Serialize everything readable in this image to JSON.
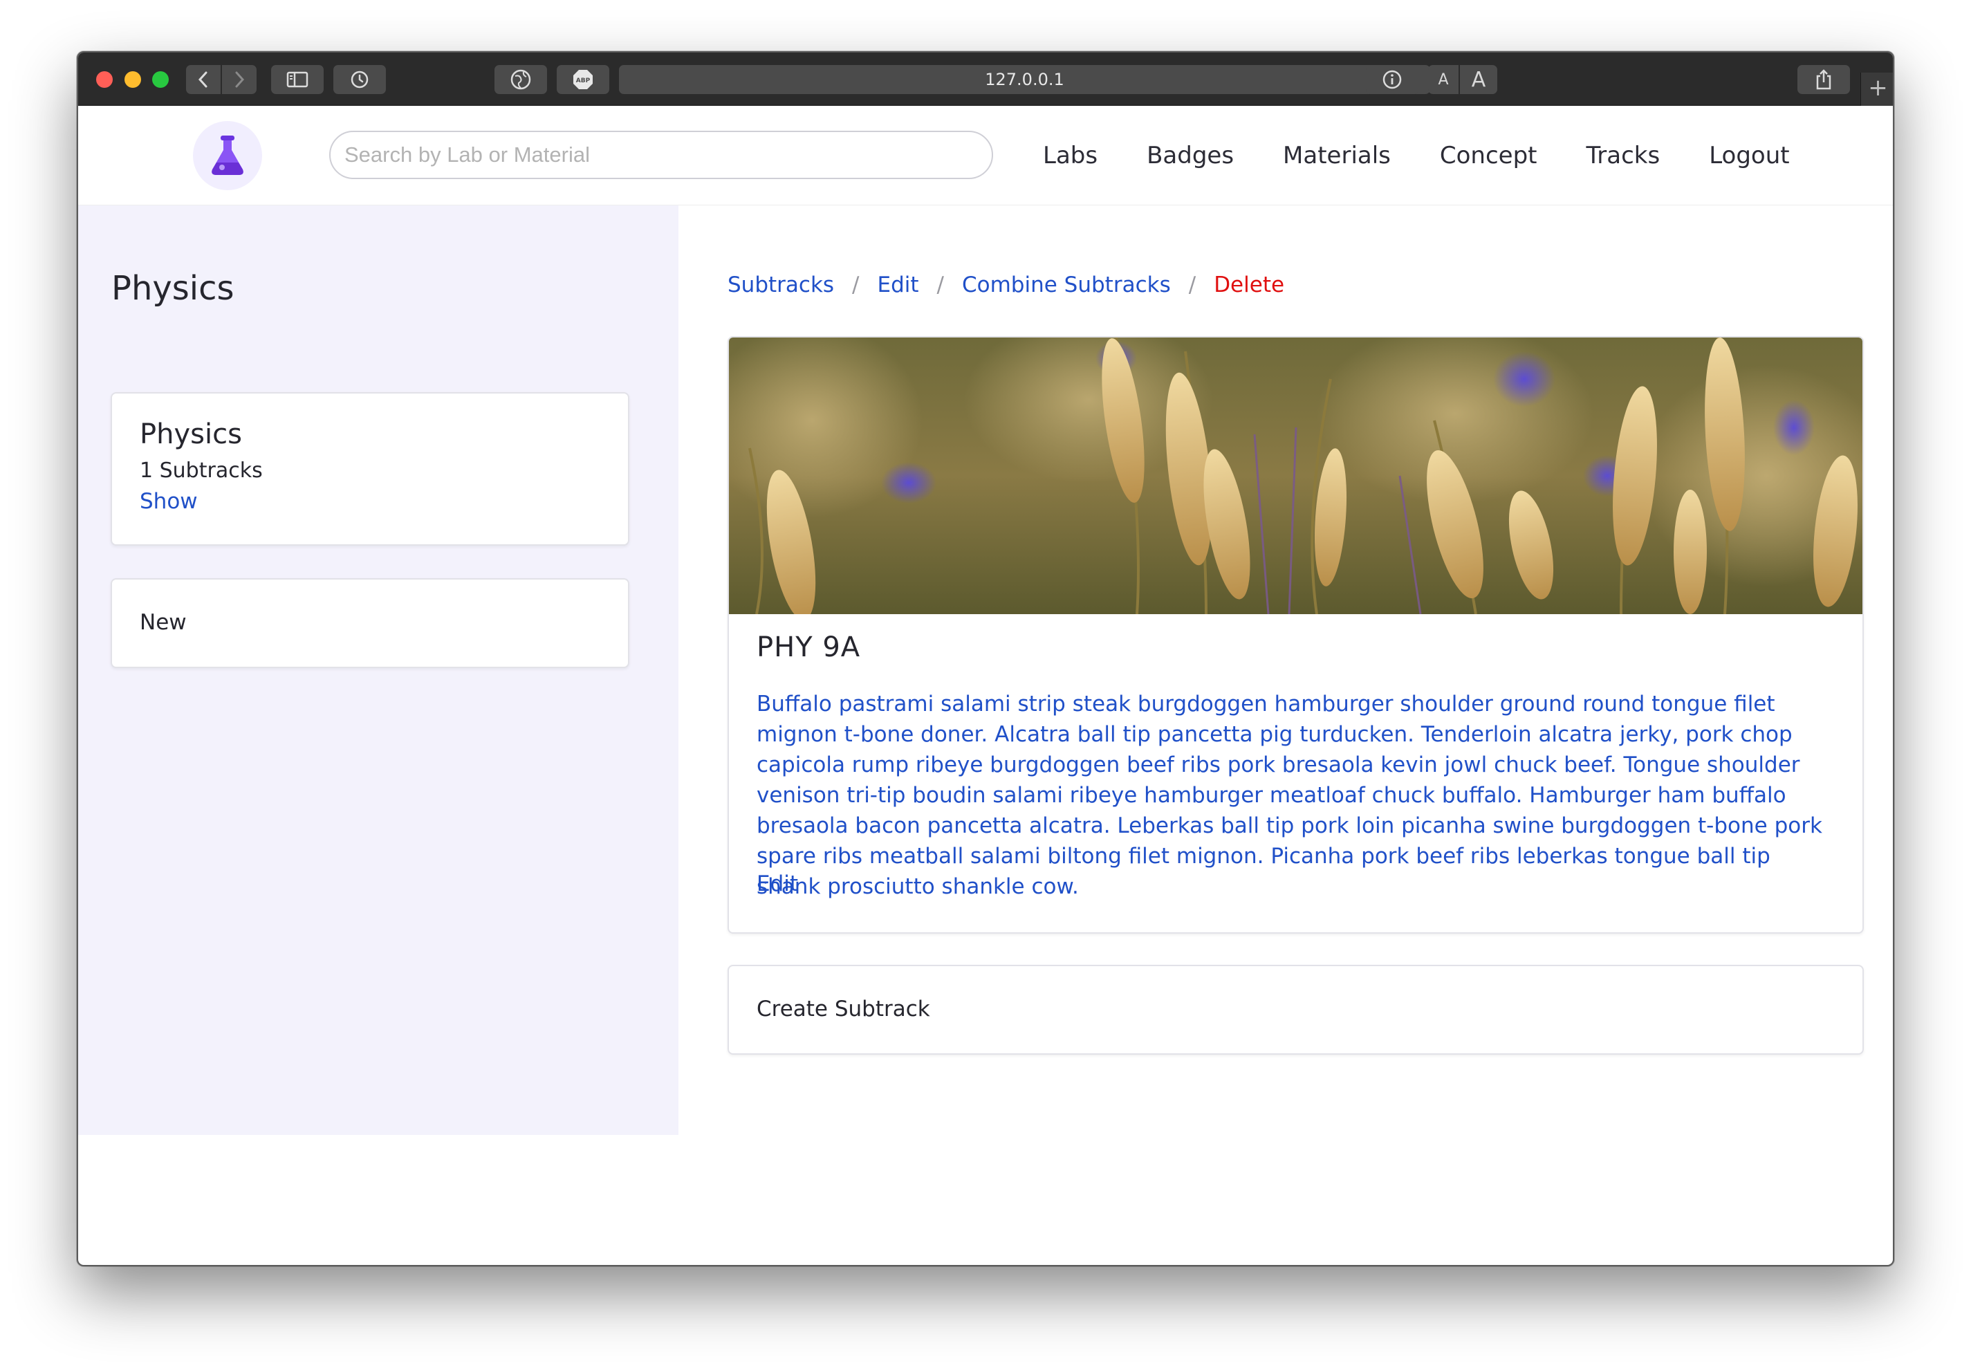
{
  "browser": {
    "url": "127.0.0.1",
    "reader_small": "A",
    "reader_large": "A",
    "new_tab": "+"
  },
  "navbar": {
    "search_placeholder": "Search by Lab or Material",
    "links": [
      "Labs",
      "Badges",
      "Materials",
      "Concept",
      "Tracks",
      "Logout"
    ]
  },
  "sidebar": {
    "title": "Physics",
    "track_card": {
      "title": "Physics",
      "subtitle": "1 Subtracks",
      "link": "Show"
    },
    "new_card": {
      "label": "New"
    }
  },
  "breadcrumb": {
    "subtracks": "Subtracks",
    "edit": "Edit",
    "combine": "Combine Subtracks",
    "delete": "Delete",
    "separator": "/"
  },
  "subtrack": {
    "title": "PHY 9A",
    "description": "Buffalo pastrami salami strip steak burgdoggen hamburger shoulder ground round tongue filet mignon t-bone doner. Alcatra ball tip pancetta pig turducken. Tenderloin alcatra jerky, pork chop capicola rump ribeye burgdoggen beef ribs pork bresaola kevin jowl chuck beef. Tongue shoulder venison tri-tip boudin salami ribeye hamburger meatloaf chuck buffalo. Hamburger ham buffalo bresaola bacon pancetta alcatra. Leberkas ball tip pork loin picanha swine burgdoggen t-bone pork spare ribs meatball salami biltong filet mignon. Picanha pork beef ribs leberkas tongue ball tip shank prosciutto shankle cow.",
    "edit_link": "Edit"
  },
  "create_card": {
    "label": "Create Subtrack"
  },
  "colors": {
    "link": "#2050c8",
    "danger": "#e01010",
    "sidebar_bg": "#f3f2fc",
    "brand": "#7a3cf0"
  }
}
